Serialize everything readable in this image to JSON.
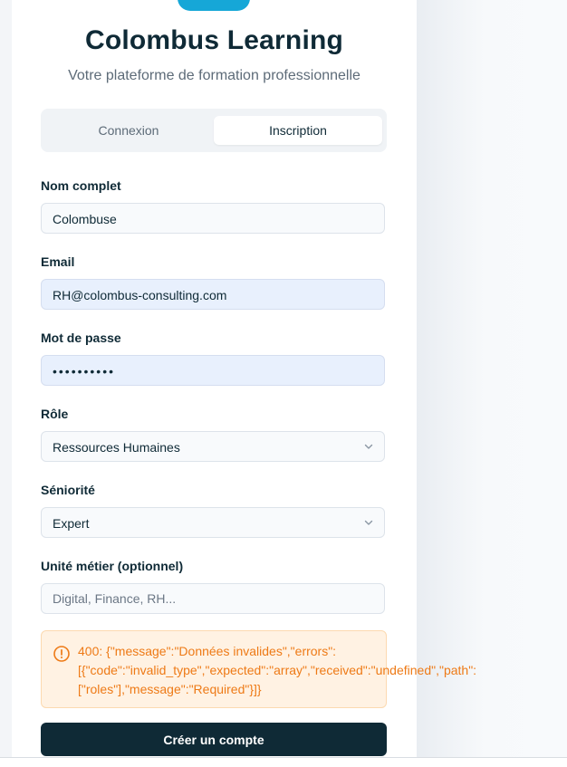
{
  "app": {
    "title": "Colombus Learning",
    "subtitle": "Votre plateforme de formation professionnelle"
  },
  "tabs": [
    {
      "label": "Connexion",
      "active": false
    },
    {
      "label": "Inscription",
      "active": true
    }
  ],
  "form": {
    "name": {
      "label": "Nom complet",
      "value": "Colombuse"
    },
    "email": {
      "label": "Email",
      "value": "RH@colombus-consulting.com"
    },
    "password": {
      "label": "Mot de passe",
      "value": "••••••••••"
    },
    "role": {
      "label": "Rôle",
      "value": "Ressources Humaines"
    },
    "seniority": {
      "label": "Séniorité",
      "value": "Expert"
    },
    "business_unit": {
      "label": "Unité métier (optionnel)",
      "placeholder": "Digital, Finance, RH..."
    }
  },
  "error": {
    "message": "400: {\"message\":\"Données invalides\",\"errors\":\n[{\"code\":\"invalid_type\",\"expected\":\"array\",\"received\":\"undefined\",\"path\":\n[\"roles\"],\"message\":\"Required\"}]}"
  },
  "submit_label": "Créer un compte",
  "colors": {
    "brand": "#0f2a36",
    "accent": "#16a7d7",
    "error_text": "#ee7a16",
    "error_bg": "#fff2e3"
  },
  "icons": {
    "alert": "alert-circle-icon",
    "chevron": "chevron-down-icon"
  }
}
